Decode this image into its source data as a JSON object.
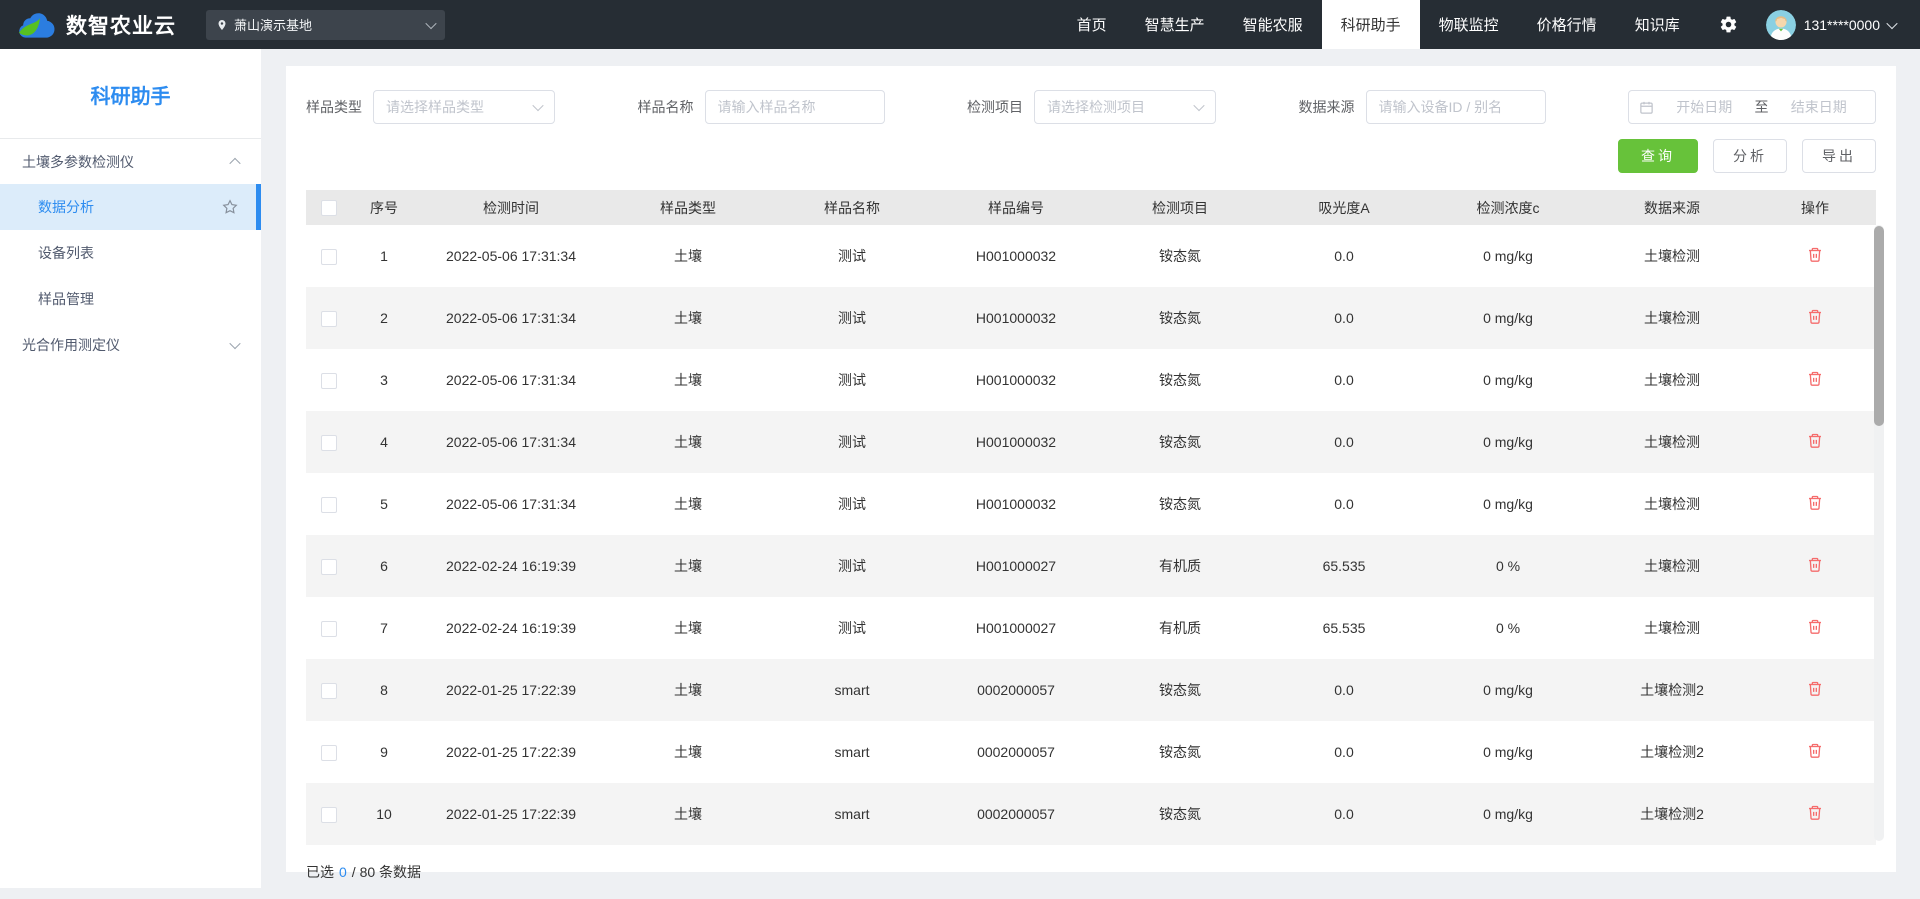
{
  "colors": {
    "accent_blue": "#2d8cf0",
    "primary_green": "#67c23a",
    "danger_red": "#f56c6c",
    "navbar_bg": "#262d34"
  },
  "icons": {
    "brand": "cloud-leaf-logo",
    "base": "location-pin-icon",
    "settings": "gear-icon",
    "user": "avatar",
    "date": "calendar-icon",
    "favorite": "star-outline-icon",
    "delete": "trash-icon",
    "expand": "chevron-icons"
  },
  "navbar": {
    "brand": "数智农业云",
    "base_selector": {
      "value": "萧山演示基地"
    },
    "items": [
      {
        "label": "首页",
        "active": false
      },
      {
        "label": "智慧生产",
        "active": false
      },
      {
        "label": "智能农服",
        "active": false
      },
      {
        "label": "科研助手",
        "active": true
      },
      {
        "label": "物联监控",
        "active": false
      },
      {
        "label": "价格行情",
        "active": false
      },
      {
        "label": "知识库",
        "active": false
      }
    ],
    "user": {
      "phone": "131****0000"
    }
  },
  "sidebar": {
    "title": "科研助手",
    "groups": [
      {
        "label": "土壤多参数检测仪",
        "expanded": true,
        "children": [
          {
            "label": "数据分析",
            "active": true,
            "starred": true
          },
          {
            "label": "设备列表",
            "active": false,
            "starred": false
          },
          {
            "label": "样品管理",
            "active": false,
            "starred": false
          }
        ]
      },
      {
        "label": "光合作用测定仪",
        "expanded": false,
        "children": []
      }
    ]
  },
  "filters": {
    "sample_type": {
      "label": "样品类型",
      "placeholder": "请选择样品类型"
    },
    "sample_name": {
      "label": "样品名称",
      "placeholder": "请输入样品名称"
    },
    "test_item": {
      "label": "检测项目",
      "placeholder": "请选择检测项目"
    },
    "data_source": {
      "label": "数据来源",
      "placeholder": "请输入设备ID / 别名"
    },
    "date_range": {
      "start_placeholder": "开始日期",
      "separator": "至",
      "end_placeholder": "结束日期"
    }
  },
  "actions": {
    "query": "查询",
    "analyze": "分析",
    "export": "导出"
  },
  "table": {
    "columns": [
      "序号",
      "检测时间",
      "样品类型",
      "样品名称",
      "样品编号",
      "检测项目",
      "吸光度A",
      "检测浓度c",
      "数据来源",
      "操作"
    ],
    "rows": [
      {
        "no": "1",
        "time": "2022-05-06 17:31:34",
        "type": "土壤",
        "name": "测试",
        "code": "H001000032",
        "item": "铵态氮",
        "absorbance": "0.0",
        "concentration": "0 mg/kg",
        "source": "土壤检测"
      },
      {
        "no": "2",
        "time": "2022-05-06 17:31:34",
        "type": "土壤",
        "name": "测试",
        "code": "H001000032",
        "item": "铵态氮",
        "absorbance": "0.0",
        "concentration": "0 mg/kg",
        "source": "土壤检测"
      },
      {
        "no": "3",
        "time": "2022-05-06 17:31:34",
        "type": "土壤",
        "name": "测试",
        "code": "H001000032",
        "item": "铵态氮",
        "absorbance": "0.0",
        "concentration": "0 mg/kg",
        "source": "土壤检测"
      },
      {
        "no": "4",
        "time": "2022-05-06 17:31:34",
        "type": "土壤",
        "name": "测试",
        "code": "H001000032",
        "item": "铵态氮",
        "absorbance": "0.0",
        "concentration": "0 mg/kg",
        "source": "土壤检测"
      },
      {
        "no": "5",
        "time": "2022-05-06 17:31:34",
        "type": "土壤",
        "name": "测试",
        "code": "H001000032",
        "item": "铵态氮",
        "absorbance": "0.0",
        "concentration": "0 mg/kg",
        "source": "土壤检测"
      },
      {
        "no": "6",
        "time": "2022-02-24 16:19:39",
        "type": "土壤",
        "name": "测试",
        "code": "H001000027",
        "item": "有机质",
        "absorbance": "65.535",
        "concentration": "0 %",
        "source": "土壤检测"
      },
      {
        "no": "7",
        "time": "2022-02-24 16:19:39",
        "type": "土壤",
        "name": "测试",
        "code": "H001000027",
        "item": "有机质",
        "absorbance": "65.535",
        "concentration": "0 %",
        "source": "土壤检测"
      },
      {
        "no": "8",
        "time": "2022-01-25 17:22:39",
        "type": "土壤",
        "name": "smart",
        "code": "0002000057",
        "item": "铵态氮",
        "absorbance": "0.0",
        "concentration": "0 mg/kg",
        "source": "土壤检测2"
      },
      {
        "no": "9",
        "time": "2022-01-25 17:22:39",
        "type": "土壤",
        "name": "smart",
        "code": "0002000057",
        "item": "铵态氮",
        "absorbance": "0.0",
        "concentration": "0 mg/kg",
        "source": "土壤检测2"
      },
      {
        "no": "10",
        "time": "2022-01-25 17:22:39",
        "type": "土壤",
        "name": "smart",
        "code": "0002000057",
        "item": "铵态氮",
        "absorbance": "0.0",
        "concentration": "0 mg/kg",
        "source": "土壤检测2"
      }
    ]
  },
  "footer": {
    "prefix": "已选",
    "selected": "0",
    "suffix": "/ 80 条数据"
  }
}
